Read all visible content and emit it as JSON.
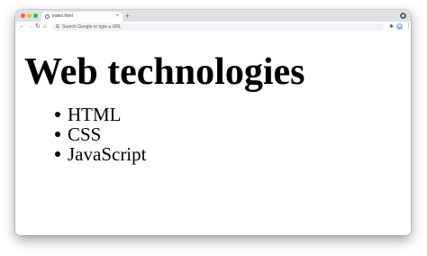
{
  "browser": {
    "tab": {
      "title": "index.html",
      "close_glyph": "×"
    },
    "new_tab_glyph": "+",
    "toolbar": {
      "back_glyph": "←",
      "forward_glyph": "→",
      "reload_glyph": "↻",
      "home_glyph": "⌂",
      "omnibox_icon": "G",
      "omnibox_placeholder": "Search Google or type a URL",
      "extensions_glyph": "✱",
      "menu_glyph": "⋮"
    },
    "colors": {
      "tabbar": "#dfe1e5",
      "traffic_close": "#fe5f57",
      "traffic_minimize": "#febc2e",
      "traffic_zoom": "#28c840"
    }
  },
  "page": {
    "heading": "Web technologies",
    "items": [
      "HTML",
      "CSS",
      "JavaScript"
    ]
  }
}
